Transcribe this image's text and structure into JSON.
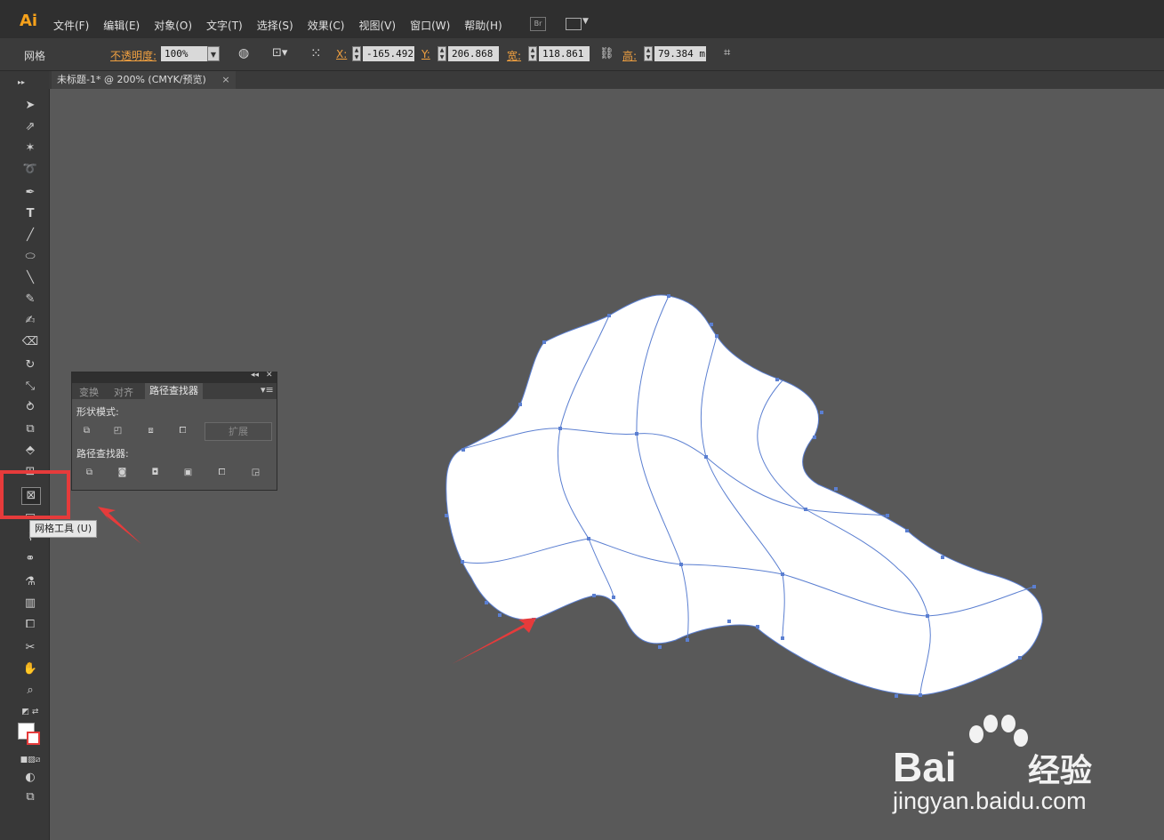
{
  "app": {
    "logo": "Ai"
  },
  "menu": [
    "文件(F)",
    "编辑(E)",
    "对象(O)",
    "文字(T)",
    "选择(S)",
    "效果(C)",
    "视图(V)",
    "窗口(W)",
    "帮助(H)"
  ],
  "bridge_label": "Br",
  "control": {
    "mode_label": "网格",
    "opacity_label": "不透明度:",
    "opacity_value": "100%",
    "x_label": "X:",
    "x_value": "-165.492",
    "y_label": "Y:",
    "y_value": "206.868 r",
    "w_label": "宽:",
    "w_value": "118.861 r",
    "h_label": "高:",
    "h_value": "79.384 m"
  },
  "document_tab": {
    "title": "未标题-1* @ 200% (CMYK/预览)",
    "close": "×"
  },
  "pathfinder_panel": {
    "tabs": [
      "变换",
      "对齐",
      "路径查找器"
    ],
    "active_tab": 2,
    "shape_modes_label": "形状模式:",
    "expand_label": "扩展",
    "pathfinders_label": "路径查找器:"
  },
  "tooltip": "网格工具 (U)",
  "watermark": {
    "brand": "Bai",
    "brand_cn": "经验",
    "url": "jingyan.baidu.com"
  },
  "colors": {
    "accent": "#f7a21b",
    "highlight": "#e63b3b",
    "mesh_line": "#5b7fd1",
    "shape_fill": "#ffffff"
  },
  "tools": [
    "selection-tool",
    "direct-selection-tool",
    "magic-wand-tool",
    "lasso-tool",
    "pen-tool",
    "type-tool",
    "line-tool",
    "ellipse-tool",
    "paintbrush-tool",
    "pencil-tool",
    "blob-brush-tool",
    "eraser-tool",
    "rotate-tool",
    "scale-tool",
    "warp-tool",
    "free-transform-tool",
    "shape-builder-tool",
    "perspective-grid-tool",
    "mesh-tool",
    "gradient-tool",
    "eyedropper-tool",
    "blend-tool",
    "symbol-sprayer-tool",
    "column-graph-tool",
    "artboard-tool",
    "slice-tool",
    "hand-tool",
    "zoom-tool"
  ]
}
